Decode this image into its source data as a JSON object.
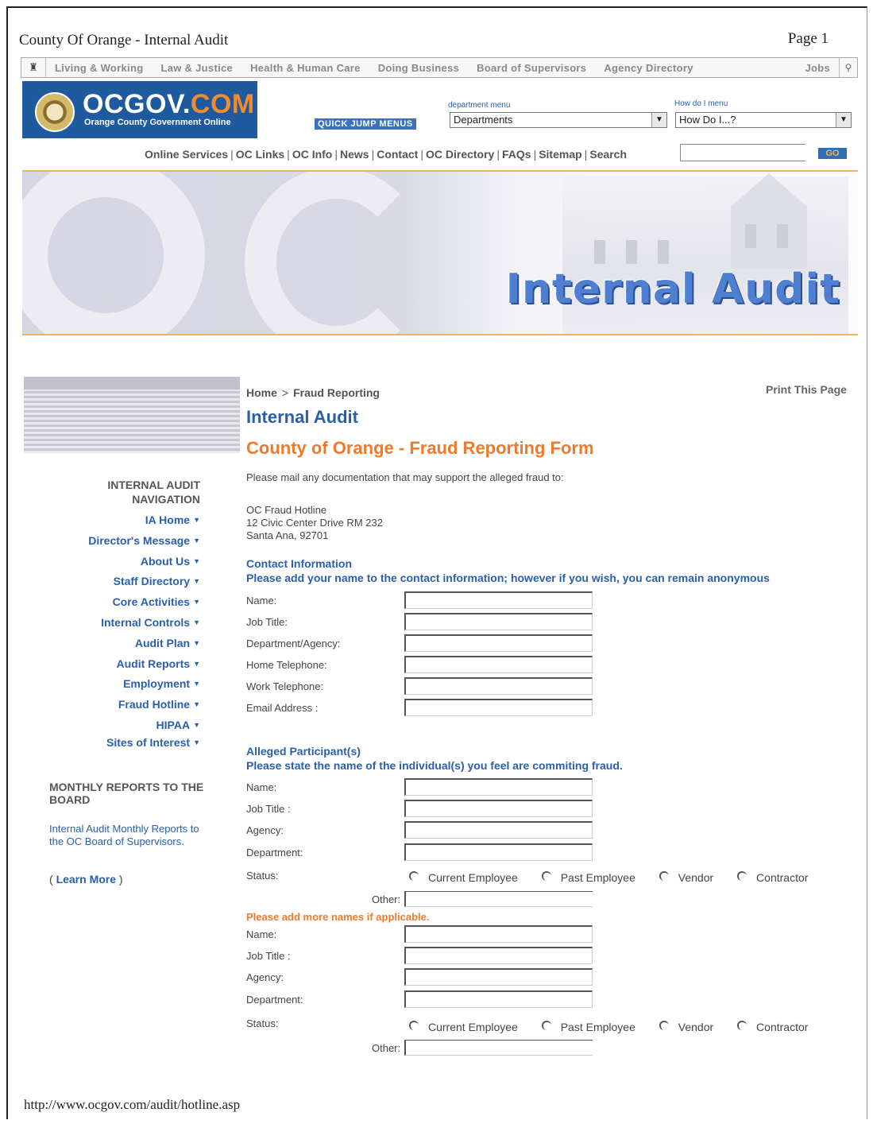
{
  "print": {
    "title": "County Of Orange - Internal Audit",
    "page": "Page 1",
    "url": "http://www.ocgov.com/audit/hotline.asp"
  },
  "topnav": {
    "items": [
      "Living & Working",
      "Law & Justice",
      "Health & Human Care",
      "Doing Business",
      "Board of Supervisors",
      "Agency Directory"
    ],
    "jobs": "Jobs"
  },
  "logo": {
    "brand_main": "OCGOV.",
    "brand_com": "COM",
    "tagline": "Orange County Government Online"
  },
  "quickjump": {
    "label": "QUICK JUMP MENUS",
    "dept_label": "department menu",
    "dept_value": "Departments",
    "howdo_label": "How do I menu",
    "howdo_value": "How Do I...?"
  },
  "utilnav": {
    "items": [
      "Online Services",
      "OC Links",
      "OC Info",
      "News",
      "Contact",
      "OC Directory",
      "FAQs",
      "Sitemap",
      "Search"
    ],
    "go": "GO"
  },
  "banner": {
    "title": "Internal Audit"
  },
  "sidebar": {
    "nav_title": "INTERNAL AUDIT NAVIGATION",
    "items": [
      "IA Home",
      "Director's Message",
      "About Us",
      "Staff Directory",
      "Core Activities",
      "Internal Controls",
      "Audit Plan",
      "Audit Reports",
      "Employment",
      "Fraud Hotline",
      "HIPAA",
      "Sites of Interest"
    ],
    "reports_title": "MONTHLY REPORTS TO THE BOARD",
    "reports_link": "Internal Audit Monthly Reports to the OC Board of Supervisors.",
    "learn_open": "( ",
    "learn_more": "Learn More",
    "learn_close": " )"
  },
  "main": {
    "crumb_home": "Home",
    "crumb_sep": ">",
    "crumb_current": "Fraud Reporting",
    "print_page": "Print This Page",
    "heading": "Internal Audit",
    "form_title": "County of Orange - Fraud Reporting Form",
    "intro": "Please mail any documentation that may support the alleged fraud to:",
    "address": [
      "OC Fraud Hotline",
      "12 Civic Center Drive RM 232",
      "Santa Ana, 92701"
    ],
    "contact": {
      "title": "Contact Information",
      "subtitle": "Please add your name to the contact information; however if you wish, you can remain anonymous",
      "fields": [
        "Name:",
        "Job Title:",
        "Department/Agency:",
        "Home Telephone:",
        "Work Telephone:",
        "Email Address :"
      ]
    },
    "alleged": {
      "title": "Alleged Participant(s)",
      "subtitle": "Please state the name of the individual(s) you feel are commiting fraud.",
      "fields": [
        "Name:",
        "Job Title :",
        "Agency:",
        "Department:"
      ],
      "status_label": "Status:",
      "status_options": [
        "Current Employee",
        "Past Employee",
        "Vendor",
        "Contractor"
      ],
      "other_label": "Other:"
    },
    "more_names": "Please add more names if applicable.",
    "alleged2": {
      "fields": [
        "Name:",
        "Job Title :",
        "Agency:",
        "Department:"
      ],
      "status_label": "Status:",
      "status_options": [
        "Current Employee",
        "Past Employee",
        "Vendor",
        "Contractor"
      ],
      "other_label": "Other:"
    }
  }
}
